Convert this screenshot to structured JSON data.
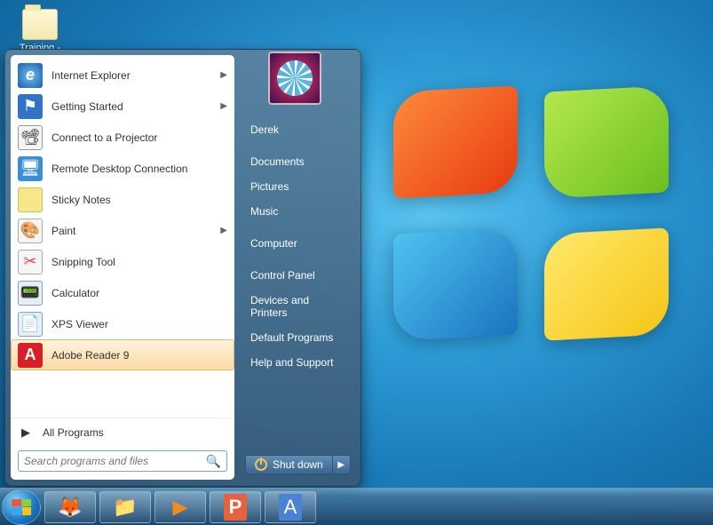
{
  "desktop": {
    "icon_label": "Training -"
  },
  "start_menu": {
    "left_items": [
      {
        "label": "Internet Explorer",
        "has_submenu": true,
        "icon": "ie"
      },
      {
        "label": "Getting Started",
        "has_submenu": true,
        "icon": "gs"
      },
      {
        "label": "Connect to a Projector",
        "has_submenu": false,
        "icon": "proj"
      },
      {
        "label": "Remote Desktop Connection",
        "has_submenu": false,
        "icon": "rdc"
      },
      {
        "label": "Sticky Notes",
        "has_submenu": false,
        "icon": "sticky"
      },
      {
        "label": "Paint",
        "has_submenu": true,
        "icon": "paint"
      },
      {
        "label": "Snipping Tool",
        "has_submenu": false,
        "icon": "snip"
      },
      {
        "label": "Calculator",
        "has_submenu": false,
        "icon": "calc"
      },
      {
        "label": "XPS Viewer",
        "has_submenu": false,
        "icon": "xps"
      },
      {
        "label": "Adobe Reader 9",
        "has_submenu": false,
        "icon": "adobe",
        "hover": true
      }
    ],
    "all_programs_label": "All Programs",
    "search_placeholder": "Search programs and files",
    "right_items": [
      "Derek",
      "Documents",
      "Pictures",
      "Music",
      "Computer",
      "Control Panel",
      "Devices and Printers",
      "Default Programs",
      "Help and Support"
    ],
    "shutdown_label": "Shut down"
  },
  "taskbar": {
    "pinned": [
      {
        "name": "firefox",
        "glyph": "🦊"
      },
      {
        "name": "explorer",
        "glyph": "📁"
      },
      {
        "name": "media-player",
        "glyph": "▶"
      },
      {
        "name": "powerpoint",
        "glyph": "P"
      },
      {
        "name": "word",
        "glyph": "A"
      }
    ]
  }
}
